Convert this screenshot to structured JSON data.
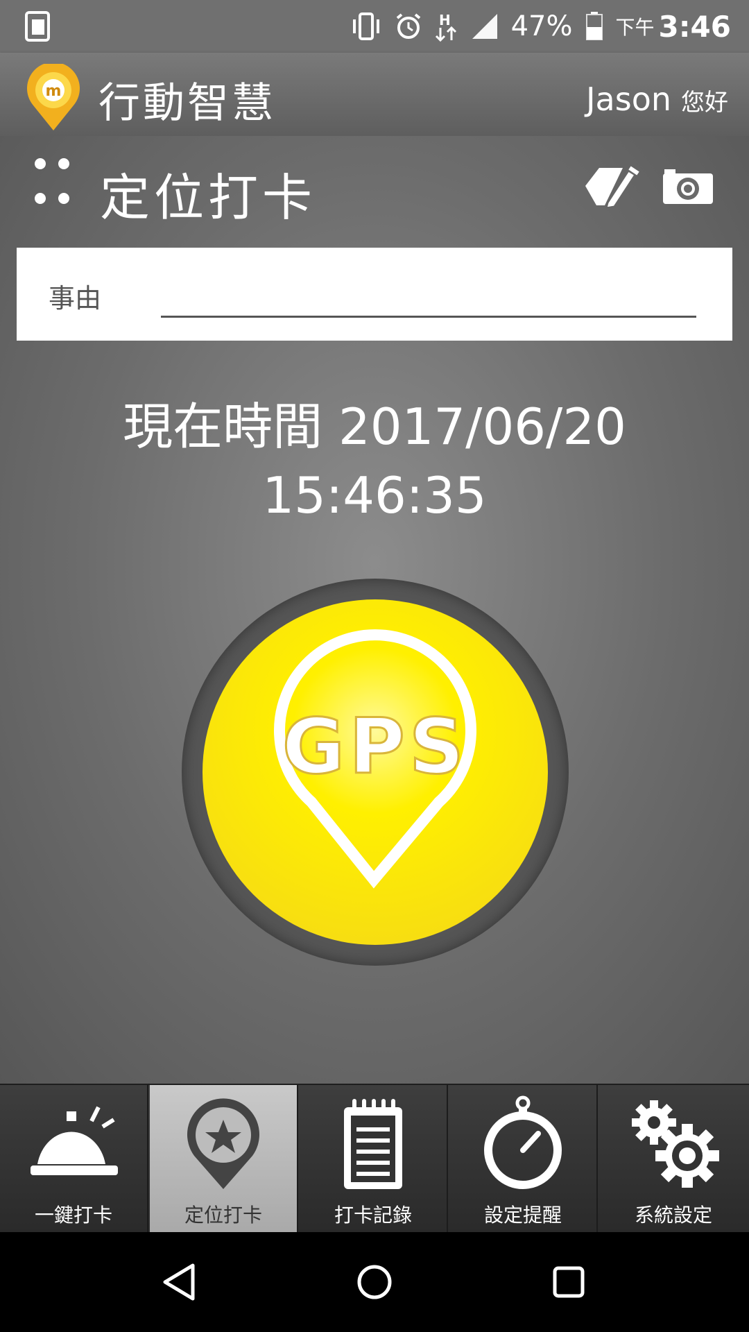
{
  "status_bar": {
    "battery": "47%",
    "ampm": "下午",
    "time": "3:46"
  },
  "header": {
    "app_title": "行動智慧",
    "user_name": "Jason",
    "greeting": "您好"
  },
  "page": {
    "title": "定位打卡"
  },
  "reason": {
    "label": "事由",
    "value": ""
  },
  "current_time": {
    "line1": "現在時間 2017/06/20",
    "line2": "15:46:35"
  },
  "gps_button": {
    "text": "GPS"
  },
  "bottom_nav": {
    "items": [
      {
        "label": "一鍵打卡"
      },
      {
        "label": "定位打卡"
      },
      {
        "label": "打卡記錄"
      },
      {
        "label": "設定提醒"
      },
      {
        "label": "系統設定"
      }
    ],
    "active_index": 1
  },
  "colors": {
    "gps_yellow": "#fff000",
    "logo_orange": "#f2b01e"
  }
}
